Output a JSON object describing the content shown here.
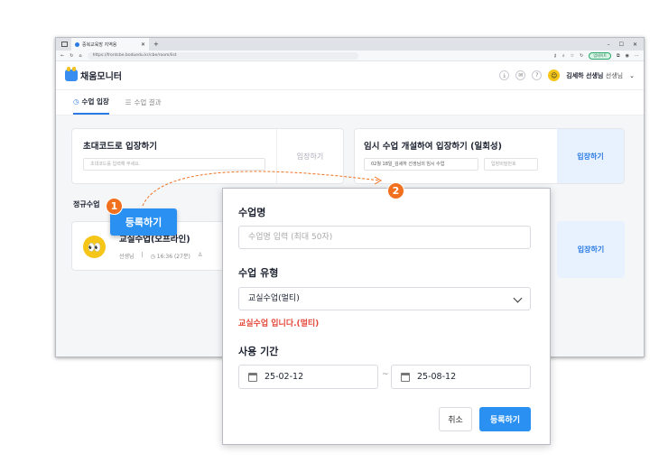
{
  "browser": {
    "tab_title": "중복교육방 지역용",
    "url": "https://frontcbe.boduedu.kr/cbe/room/list",
    "extension_pill": "업데이트"
  },
  "app": {
    "logo_text": "채움모니터",
    "user_name": "김세하 선생님",
    "user_suffix": "선생님"
  },
  "page_tabs": [
    {
      "label": "수업 입장",
      "icon": "clock-icon",
      "active": true
    },
    {
      "label": "수업 결과",
      "icon": "list-icon",
      "active": false
    }
  ],
  "card_code": {
    "title": "초대코드로 입장하기",
    "placeholder": "초대코드를 입력해 주세요.",
    "enter_label": "입장하기"
  },
  "card_temp": {
    "title": "임시 수업 개설하여 입장하기 (일회성)",
    "class_name": "02월 18일_김세하 선생님의 임시 수업",
    "password_placeholder": "입장비밀번호",
    "enter_label": "입장하기"
  },
  "regular": {
    "section_label": "정규수업",
    "register_label": "등록하기",
    "class_name": "교실수업(오프라인)",
    "teacher": "선생님",
    "time": "16:36 (27분)",
    "enter_label": "입장하기"
  },
  "annotations": {
    "badge1": "1",
    "badge2": "2"
  },
  "modal": {
    "name_label": "수업명",
    "name_placeholder": "수업명 입력 (최대 50자)",
    "type_label": "수업 유형",
    "type_value": "교실수업(멀티)",
    "type_message": "교실수업 입니다.(멀티)",
    "period_label": "사용 기간",
    "start_date": "25-02-12",
    "end_date": "25-08-12",
    "tilde": "~",
    "cancel_label": "취소",
    "register_label": "등록하기"
  },
  "colors": {
    "accent": "#2a91f2",
    "badge": "#f0701f",
    "error": "#e5483a"
  }
}
